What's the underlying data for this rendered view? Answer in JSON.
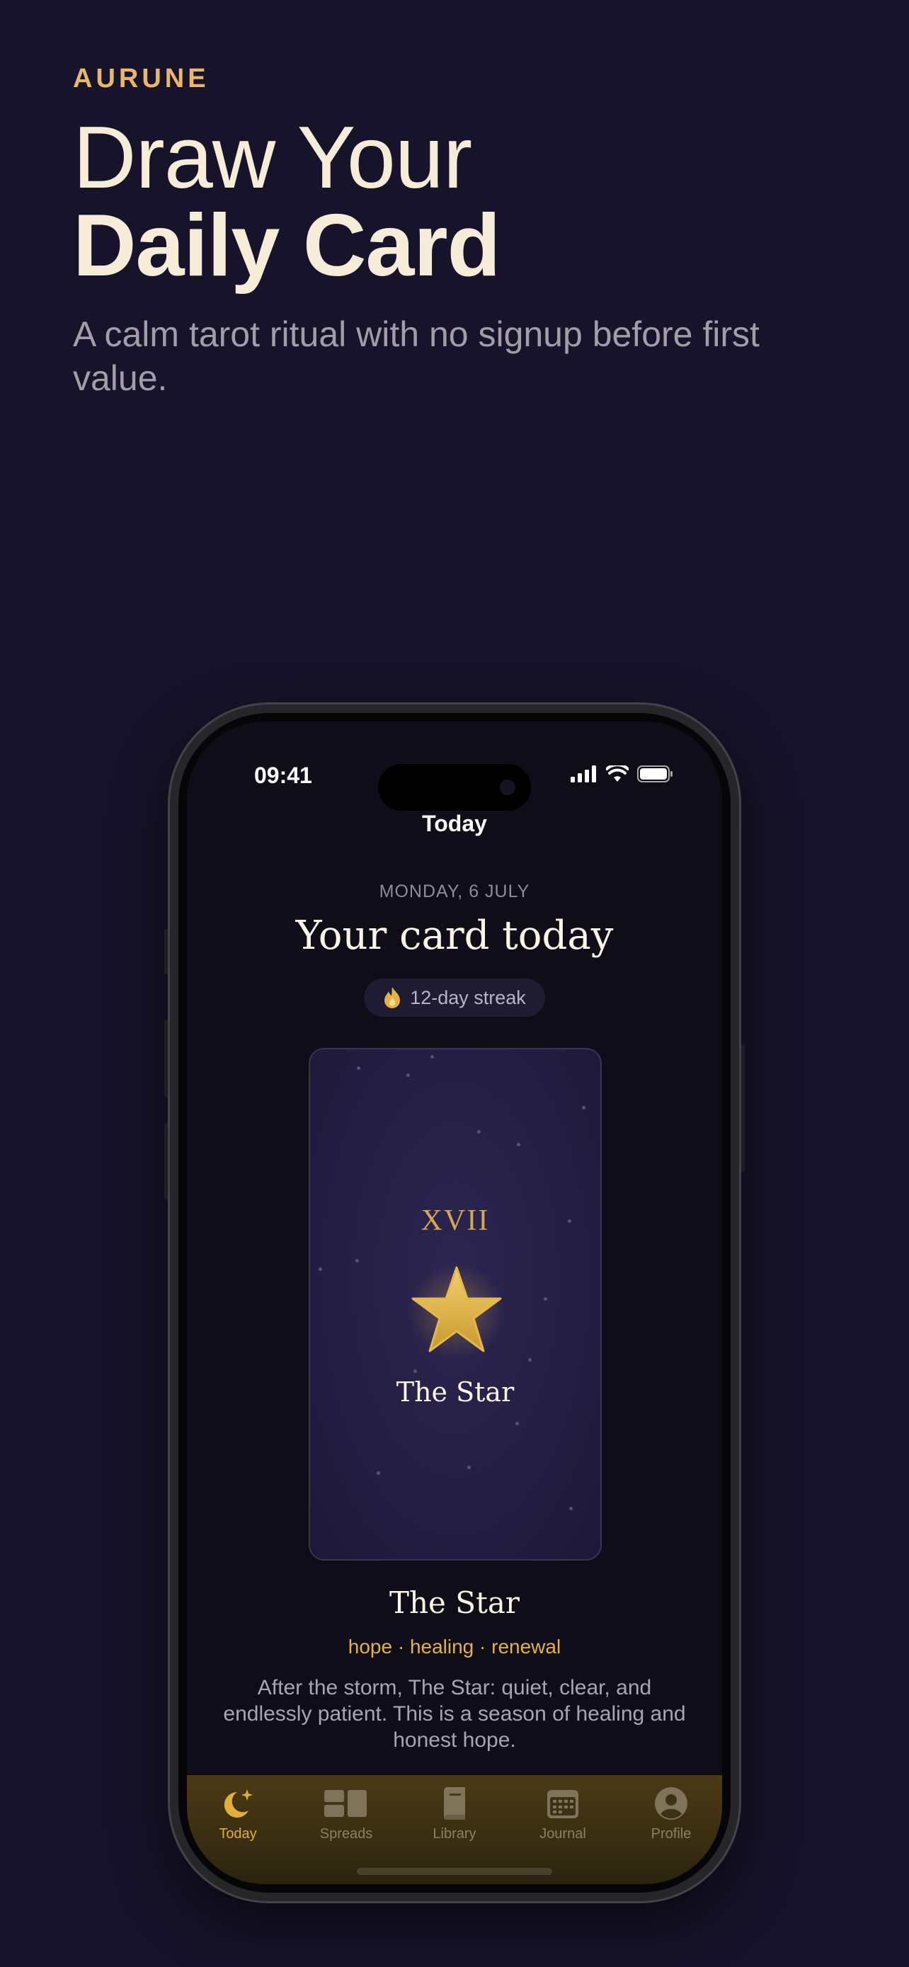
{
  "hero": {
    "brand": "AURUNE",
    "title_line1": "Draw Your",
    "title_line2": "Daily Card",
    "subtitle": "A calm tarot ritual with no signup before first value."
  },
  "status_bar": {
    "time": "09:41",
    "icons": [
      "signal-icon",
      "wifi-icon",
      "battery-icon"
    ]
  },
  "screen": {
    "nav_title": "Today",
    "date": "MONDAY, 6 JULY",
    "headline": "Your card today",
    "streak": "12-day streak",
    "card": {
      "numeral": "XVII",
      "name": "The Star",
      "icon": "star-icon"
    },
    "card_title": "The Star",
    "keywords": "hope · healing · renewal",
    "description": "After the storm, The Star: quiet, clear, and endlessly patient. This is a season of healing and honest hope."
  },
  "tabs": [
    {
      "label": "Today",
      "icon": "moon-sparkle-icon",
      "active": true
    },
    {
      "label": "Spreads",
      "icon": "spreads-icon",
      "active": false
    },
    {
      "label": "Library",
      "icon": "book-icon",
      "active": false
    },
    {
      "label": "Journal",
      "icon": "calendar-icon",
      "active": false
    },
    {
      "label": "Profile",
      "icon": "person-icon",
      "active": false
    }
  ],
  "colors": {
    "background": "#17132a",
    "accent_gold": "#e1ad3b",
    "brand": "#e8b86a",
    "title": "#f6ecd7"
  }
}
